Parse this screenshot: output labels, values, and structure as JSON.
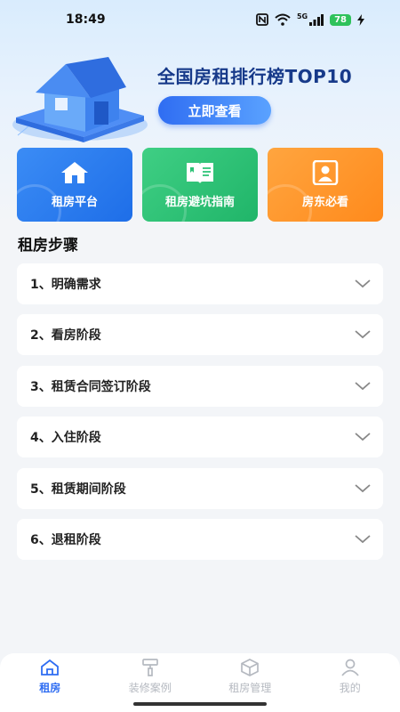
{
  "status_bar": {
    "time": "18:49",
    "network": "5G",
    "battery": "78"
  },
  "banner": {
    "title": "全国房租排行榜TOP10",
    "button_label": "立即查看"
  },
  "cards": [
    {
      "label": "租房平台",
      "icon": "house-icon",
      "color": "#2f7ff0"
    },
    {
      "label": "租房避坑指南",
      "icon": "book-icon",
      "color": "#2cc275"
    },
    {
      "label": "房东必看",
      "icon": "person-icon",
      "color": "#ff9a2e"
    }
  ],
  "section": {
    "title": "租房步骤"
  },
  "steps": [
    {
      "label": "1、明确需求"
    },
    {
      "label": "2、看房阶段"
    },
    {
      "label": "3、租赁合同签订阶段"
    },
    {
      "label": "4、入住阶段"
    },
    {
      "label": "5、租赁期间阶段"
    },
    {
      "label": "6、退租阶段"
    }
  ],
  "tabbar": {
    "items": [
      {
        "label": "租房",
        "icon": "home-icon",
        "active": true
      },
      {
        "label": "装修案例",
        "icon": "paint-roller-icon",
        "active": false
      },
      {
        "label": "租房管理",
        "icon": "box-icon",
        "active": false
      },
      {
        "label": "我的",
        "icon": "user-icon",
        "active": false
      }
    ]
  },
  "colors": {
    "accent": "#2f6df2",
    "title": "#173a8a"
  }
}
